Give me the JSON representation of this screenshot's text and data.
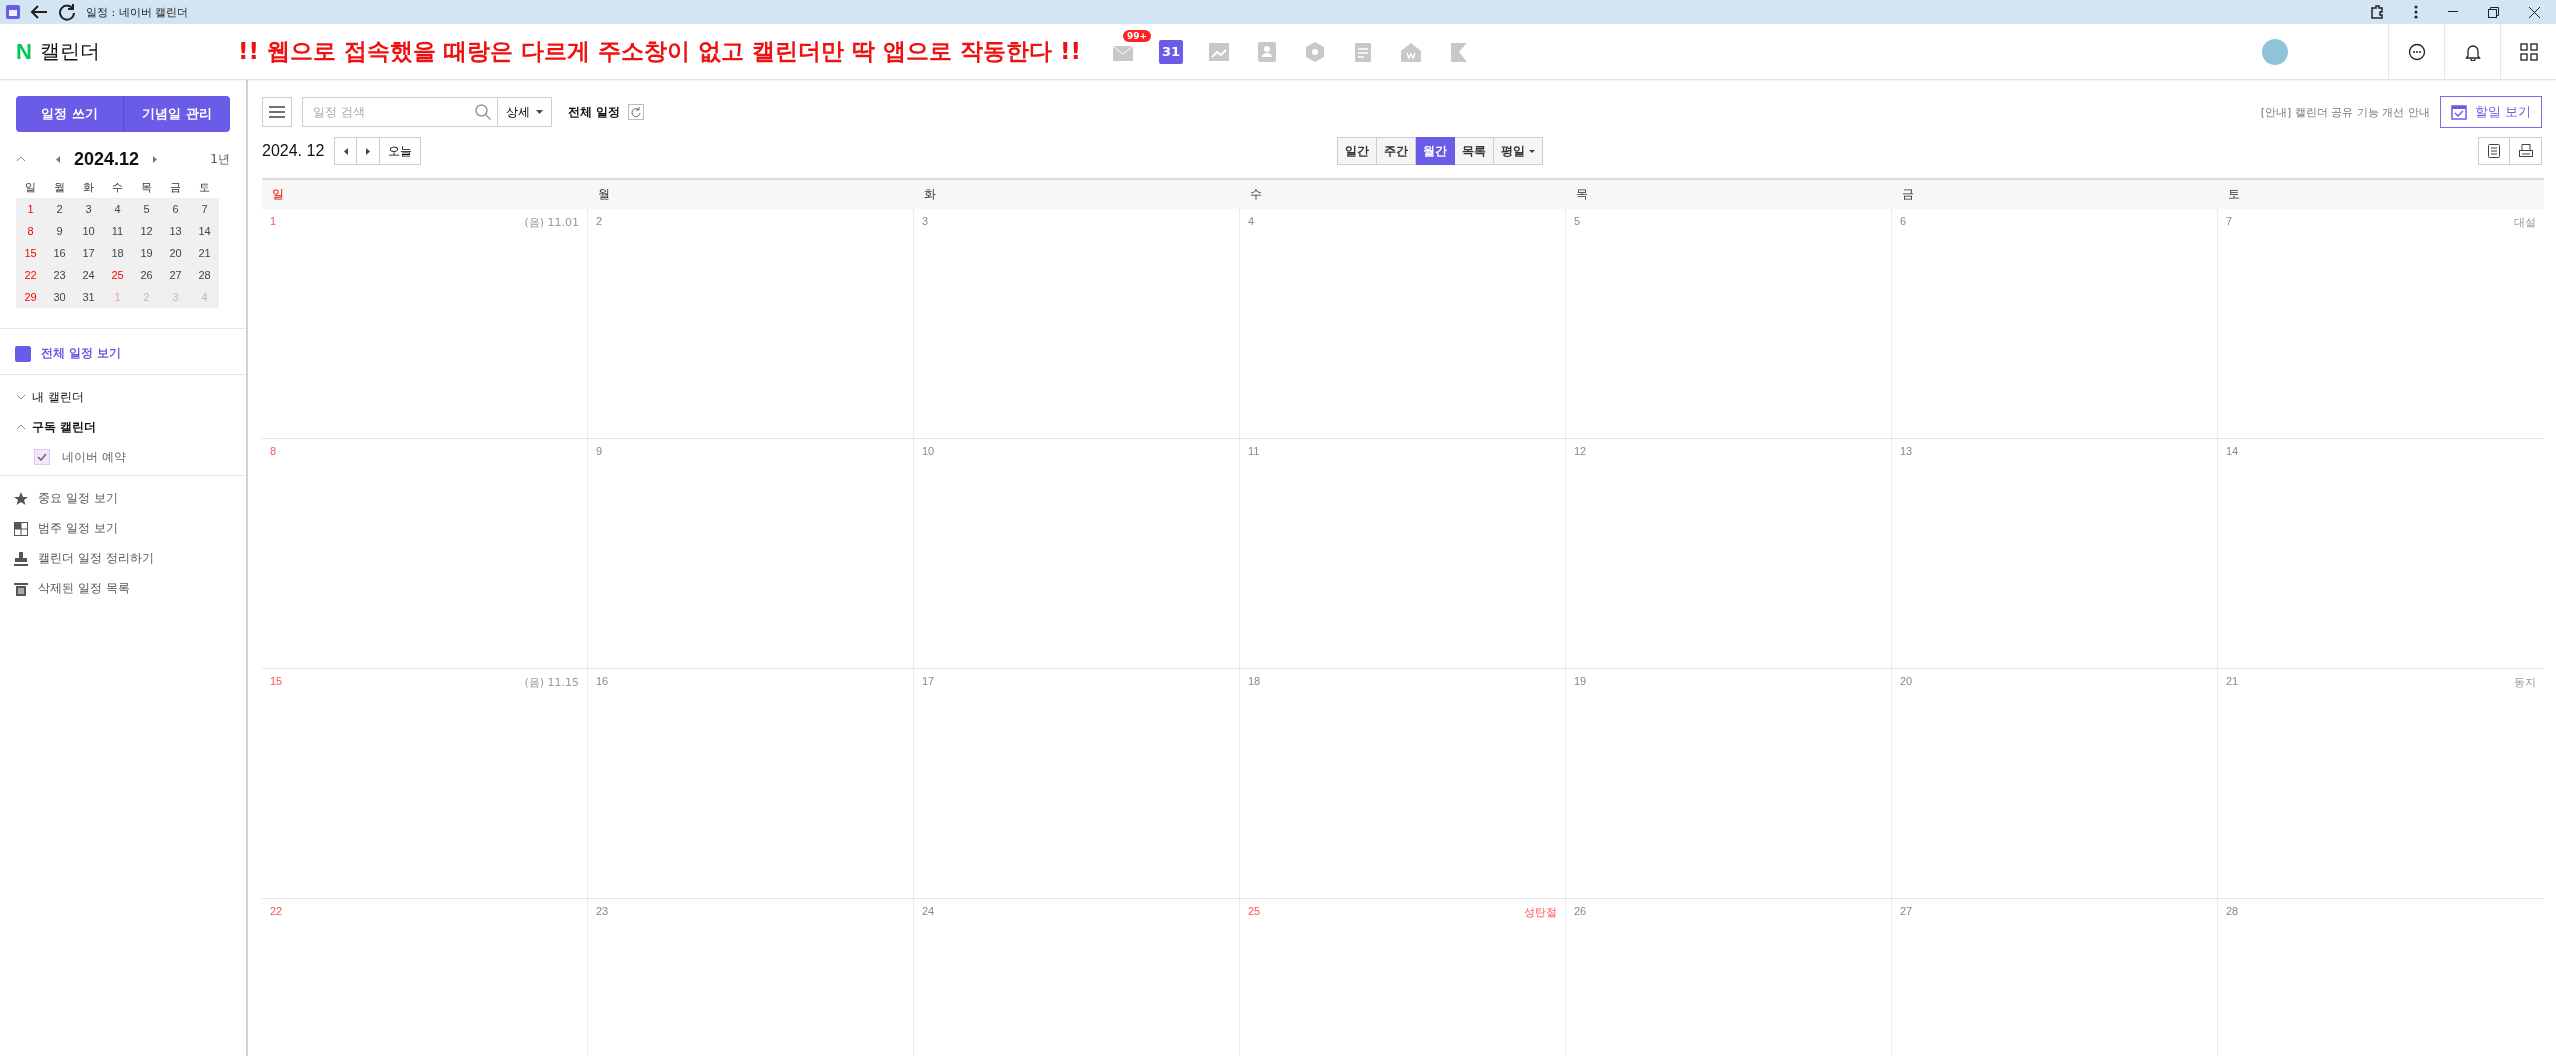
{
  "window": {
    "title": "일정 : 네이버 캘린더"
  },
  "header": {
    "logo_letter": "N",
    "logo_text": "캘린더",
    "notice": "!! 웹으로 접속했을 때랑은 다르게 주소창이 없고 캘린더만 딱 앱으로 작동한다 !!",
    "apps": [
      {
        "kind": "mail",
        "badge": "99+",
        "selected": false
      },
      {
        "kind": "calendar",
        "label": "31",
        "selected": true
      },
      {
        "kind": "blog",
        "selected": false
      },
      {
        "kind": "contacts",
        "selected": false
      },
      {
        "kind": "box",
        "selected": false
      },
      {
        "kind": "memo",
        "selected": false
      },
      {
        "kind": "pay",
        "selected": false
      },
      {
        "kind": "bookmark",
        "selected": false
      }
    ],
    "actions": [
      {
        "kind": "chat"
      },
      {
        "kind": "bell"
      },
      {
        "kind": "grid"
      }
    ]
  },
  "sidebar": {
    "buttons": [
      "일정 쓰기",
      "기념일 관리"
    ],
    "mini_calendar": {
      "title": "2024.12",
      "year_link": "1년",
      "weekdays": [
        "일",
        "월",
        "화",
        "수",
        "목",
        "금",
        "토"
      ],
      "weeks": [
        [
          {
            "d": "1",
            "kind": "holiday"
          },
          {
            "d": "2",
            "kind": "day"
          },
          {
            "d": "3",
            "kind": "day"
          },
          {
            "d": "4",
            "kind": "day"
          },
          {
            "d": "5",
            "kind": "day"
          },
          {
            "d": "6",
            "kind": "day"
          },
          {
            "d": "7",
            "kind": "day"
          }
        ],
        [
          {
            "d": "8",
            "kind": "holiday"
          },
          {
            "d": "9",
            "kind": "day"
          },
          {
            "d": "10",
            "kind": "day"
          },
          {
            "d": "11",
            "kind": "day"
          },
          {
            "d": "12",
            "kind": "day"
          },
          {
            "d": "13",
            "kind": "day"
          },
          {
            "d": "14",
            "kind": "day"
          }
        ],
        [
          {
            "d": "15",
            "kind": "holiday"
          },
          {
            "d": "16",
            "kind": "day"
          },
          {
            "d": "17",
            "kind": "day"
          },
          {
            "d": "18",
            "kind": "day"
          },
          {
            "d": "19",
            "kind": "day"
          },
          {
            "d": "20",
            "kind": "day"
          },
          {
            "d": "21",
            "kind": "day"
          }
        ],
        [
          {
            "d": "22",
            "kind": "holiday"
          },
          {
            "d": "23",
            "kind": "day"
          },
          {
            "d": "24",
            "kind": "day"
          },
          {
            "d": "25",
            "kind": "holiday"
          },
          {
            "d": "26",
            "kind": "day"
          },
          {
            "d": "27",
            "kind": "day"
          },
          {
            "d": "28",
            "kind": "day"
          }
        ],
        [
          {
            "d": "29",
            "kind": "holiday"
          },
          {
            "d": "30",
            "kind": "day"
          },
          {
            "d": "31",
            "kind": "day"
          },
          {
            "d": "1",
            "kind": "other_holiday"
          },
          {
            "d": "2",
            "kind": "other"
          },
          {
            "d": "3",
            "kind": "other"
          },
          {
            "d": "4",
            "kind": "other"
          }
        ]
      ]
    },
    "all_schedules": "전체 일정 보기",
    "calendars": [
      {
        "label": "내 캘린더",
        "expanded": false
      },
      {
        "label": "구독 캘린더",
        "expanded": true,
        "children": [
          {
            "label": "네이버 예약",
            "checked": true
          }
        ]
      }
    ],
    "tools": [
      {
        "kind": "star",
        "label": "중요 일정 보기"
      },
      {
        "kind": "category",
        "label": "범주 일정 보기"
      },
      {
        "kind": "stamp",
        "label": "캘린더 일정 정리하기"
      },
      {
        "kind": "trash",
        "label": "삭제된 일정 목록"
      }
    ]
  },
  "toolbar": {
    "search_placeholder": "일정 검색",
    "detail": "상세",
    "filter": "전체 일정",
    "notice": "[안내] 캘린더 공유 기능 개선 안내",
    "todo": "할일 보기",
    "date": "2024. 12",
    "today": "오늘",
    "views": [
      {
        "label": "일간",
        "selected": false
      },
      {
        "label": "주간",
        "selected": false
      },
      {
        "label": "월간",
        "selected": true
      },
      {
        "label": "목록",
        "selected": false
      }
    ],
    "days_filter": "평일"
  },
  "month": {
    "weekdays": [
      {
        "label": "일",
        "kind": "sunday"
      },
      {
        "label": "월",
        "kind": "day"
      },
      {
        "label": "화",
        "kind": "day"
      },
      {
        "label": "수",
        "kind": "day"
      },
      {
        "label": "목",
        "kind": "day"
      },
      {
        "label": "금",
        "kind": "day"
      },
      {
        "label": "토",
        "kind": "day"
      }
    ],
    "weeks": [
      [
        {
          "d": "1",
          "kind": "holiday",
          "note": "(음) 11.01"
        },
        {
          "d": "2",
          "kind": "day"
        },
        {
          "d": "3",
          "kind": "day"
        },
        {
          "d": "4",
          "kind": "day"
        },
        {
          "d": "5",
          "kind": "day"
        },
        {
          "d": "6",
          "kind": "day"
        },
        {
          "d": "7",
          "kind": "day",
          "note": "대설"
        }
      ],
      [
        {
          "d": "8",
          "kind": "holiday"
        },
        {
          "d": "9",
          "kind": "day"
        },
        {
          "d": "10",
          "kind": "day"
        },
        {
          "d": "11",
          "kind": "day"
        },
        {
          "d": "12",
          "kind": "day"
        },
        {
          "d": "13",
          "kind": "day"
        },
        {
          "d": "14",
          "kind": "day"
        }
      ],
      [
        {
          "d": "15",
          "kind": "holiday",
          "note": "(음) 11.15"
        },
        {
          "d": "16",
          "kind": "day"
        },
        {
          "d": "17",
          "kind": "day"
        },
        {
          "d": "18",
          "kind": "day"
        },
        {
          "d": "19",
          "kind": "day"
        },
        {
          "d": "20",
          "kind": "day"
        },
        {
          "d": "21",
          "kind": "day",
          "note": "동지"
        }
      ],
      [
        {
          "d": "22",
          "kind": "holiday"
        },
        {
          "d": "23",
          "kind": "day"
        },
        {
          "d": "24",
          "kind": "day"
        },
        {
          "d": "25",
          "kind": "holiday",
          "note": "성탄절"
        },
        {
          "d": "26",
          "kind": "day"
        },
        {
          "d": "27",
          "kind": "day"
        },
        {
          "d": "28",
          "kind": "day"
        }
      ]
    ]
  }
}
